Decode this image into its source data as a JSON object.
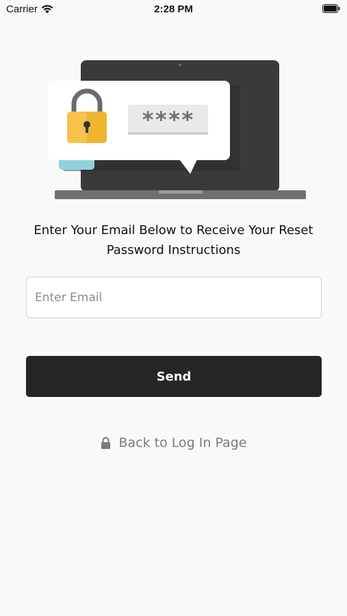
{
  "status_bar": {
    "carrier": "Carrier",
    "time": "2:28 PM"
  },
  "illustration": {
    "password_mask": "****"
  },
  "form": {
    "instructions": "Enter Your Email Below to Receive Your Reset Password Instructions",
    "email_placeholder": "Enter Email",
    "send_label": "Send",
    "back_label": "Back to Log In Page"
  },
  "colors": {
    "background": "#f9f9f9",
    "button": "#262626",
    "button_text": "#ffffff",
    "link_text": "#7a7a7a",
    "lock_gold": "#f1b42f"
  }
}
